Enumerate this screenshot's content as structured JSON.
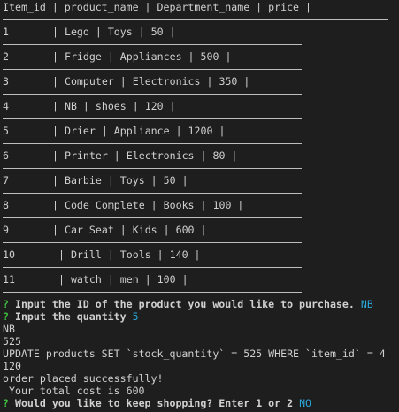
{
  "table": {
    "header": "Item_id | product_name | Department_name | price |",
    "rows": [
      {
        "id": "1",
        "rest": "| Lego | Toys | 50 |"
      },
      {
        "id": "2",
        "rest": "| Fridge | Appliances | 500 |"
      },
      {
        "id": "3",
        "rest": "| Computer | Electronics | 350 |"
      },
      {
        "id": "4",
        "rest": "| NB | shoes | 120 |"
      },
      {
        "id": "5",
        "rest": "| Drier | Appliance | 1200 |"
      },
      {
        "id": "6",
        "rest": "| Printer | Electronics | 80 |"
      },
      {
        "id": "7",
        "rest": "| Barbie | Toys | 50 |"
      },
      {
        "id": "8",
        "rest": "| Code Complete | Books | 100 |"
      },
      {
        "id": "9",
        "rest": "| Car Seat | Kids | 600 |"
      },
      {
        "id": "10",
        "rest": " | Drill | Tools | 140 |"
      },
      {
        "id": "11",
        "rest": " | watch | men | 100 |"
      }
    ]
  },
  "prompts": {
    "mark": "?",
    "q1": "Input the ID of the product you would like to purchase.",
    "a1": "NB",
    "q2": "Input the quantity",
    "a2": "5",
    "q3": "Would you like to keep shopping? Enter 1 or 2",
    "a3": "NO"
  },
  "output": [
    "NB",
    "525",
    "UPDATE products SET `stock_quantity` = 525 WHERE `item_id` = 4",
    "120",
    "order placed successfully!",
    " Your total cost is 600"
  ]
}
